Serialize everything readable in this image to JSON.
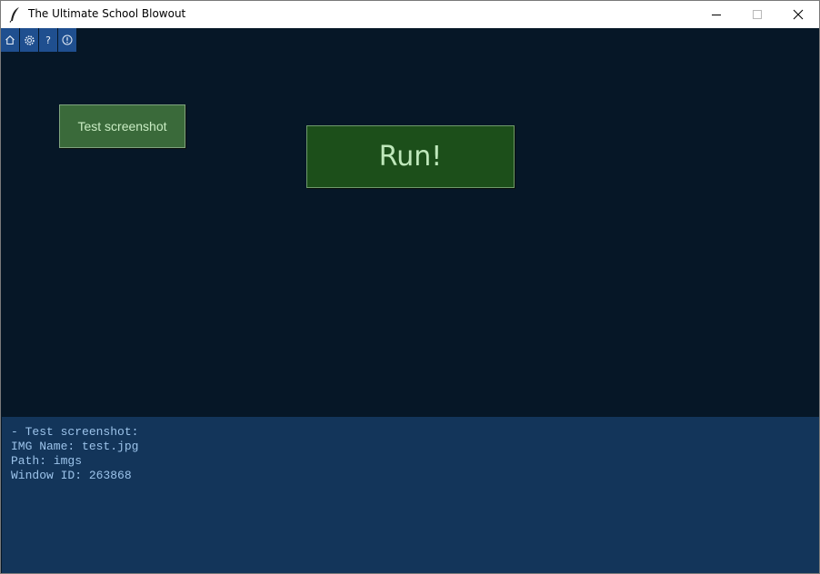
{
  "window": {
    "title": "The Ultimate School Blowout"
  },
  "toolbar": {
    "help_label": "?"
  },
  "main": {
    "test_button_label": "Test screenshot",
    "run_button_label": "Run!"
  },
  "log": {
    "lines": [
      "- Test screenshot:",
      "IMG Name: test.jpg",
      "Path: imgs",
      "Window ID: 263868"
    ]
  },
  "colors": {
    "background": "#061727",
    "log_panel": "#13355a",
    "toolbar_button": "#1f4f8f",
    "run_button": "#1c4f1a",
    "test_button": "#3a6a3a"
  }
}
